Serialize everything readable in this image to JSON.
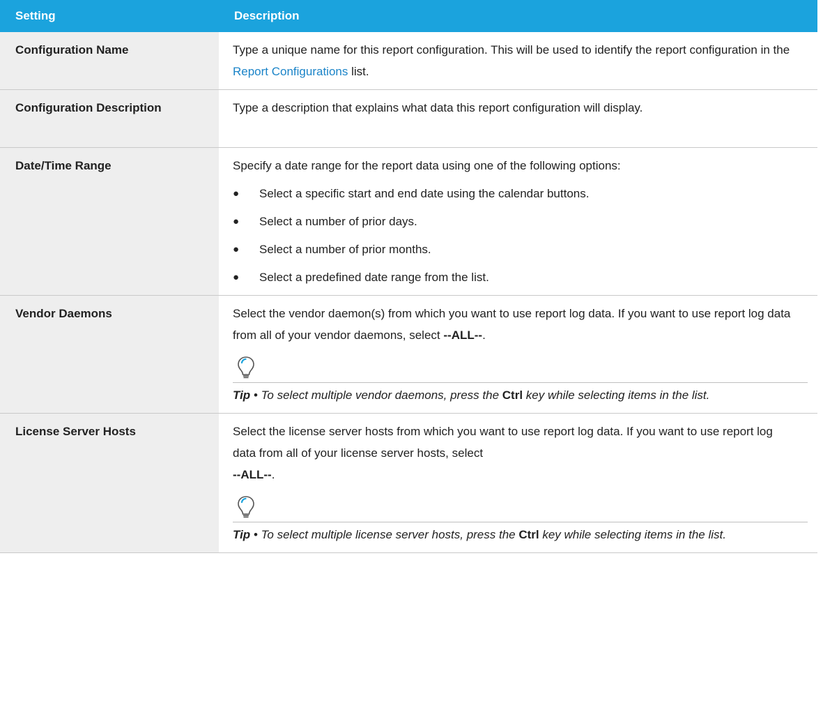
{
  "header": {
    "setting": "Setting",
    "description": "Description"
  },
  "rows": {
    "config_name": {
      "setting": "Configuration Name",
      "desc_before": "Type a unique name for this report configuration. This will be used to identify the report configuration in the ",
      "desc_link": "Report Configurations",
      "desc_after": " list."
    },
    "config_desc": {
      "setting": "Configuration Description",
      "desc": "Type a description that explains what data this report configuration will display."
    },
    "date_range": {
      "setting": "Date/Time Range",
      "desc": "Specify a date range for the report data using one of the following options:",
      "bullets": [
        "Select a specific start and end date using the calendar buttons.",
        "Select a number of prior days.",
        "Select a number of prior months.",
        "Select a predefined date range from the list."
      ]
    },
    "vendor_daemons": {
      "setting": "Vendor Daemons",
      "desc_before": "Select the vendor daemon(s) from which you want to use report log data. If you want to use report log data from all of your vendor daemons, select ",
      "desc_bold": "--ALL--",
      "desc_after": ".",
      "tip_label": "Tip",
      "tip_before": " • To select multiple vendor daemons, press the ",
      "tip_key": "Ctrl",
      "tip_after": " key while selecting items in the list."
    },
    "license_hosts": {
      "setting": "License Server Hosts",
      "desc_before": "Select the license server hosts from which you want to use report log data. If you want to use report log data from all of your license server hosts, select",
      "desc_bold": "--ALL--",
      "desc_after": ".",
      "tip_label": "Tip",
      "tip_before": " • To select multiple license server hosts, press the ",
      "tip_key": "Ctrl",
      "tip_after": " key while selecting items in the list."
    }
  },
  "icons": {
    "tip": "lightbulb-icon",
    "bullet": "bullet-dot"
  },
  "colors": {
    "header_bg": "#1ba3dd",
    "setting_bg": "#eeeeee",
    "link": "#1b84c8"
  }
}
